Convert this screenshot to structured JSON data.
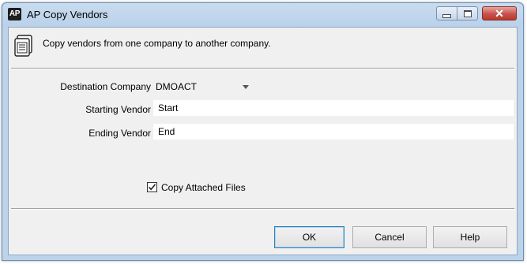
{
  "window": {
    "app_badge": "AP",
    "title": "AP Copy Vendors"
  },
  "description": "Copy vendors from one company to another company.",
  "form": {
    "destination_company": {
      "label": "Destination Company",
      "value": "DMOACT"
    },
    "starting_vendor": {
      "label": "Starting Vendor",
      "value": "Start"
    },
    "ending_vendor": {
      "label": "Ending Vendor",
      "value": "End"
    },
    "copy_attached_files": {
      "label": "Copy Attached Files",
      "checked": true
    }
  },
  "buttons": {
    "ok": "OK",
    "cancel": "Cancel",
    "help": "Help"
  },
  "icons": {
    "app": "ap-app-icon",
    "description": "document-stack-icon",
    "minimize": "minimize-icon",
    "maximize": "maximize-icon",
    "close": "close-icon",
    "dropdown": "chevron-down-icon",
    "check": "checkmark-icon"
  },
  "colors": {
    "titlebar": "#c9dcef",
    "client_bg": "#f0f0f0",
    "close_button": "#c75050",
    "default_button_border": "#3c7fb1"
  }
}
